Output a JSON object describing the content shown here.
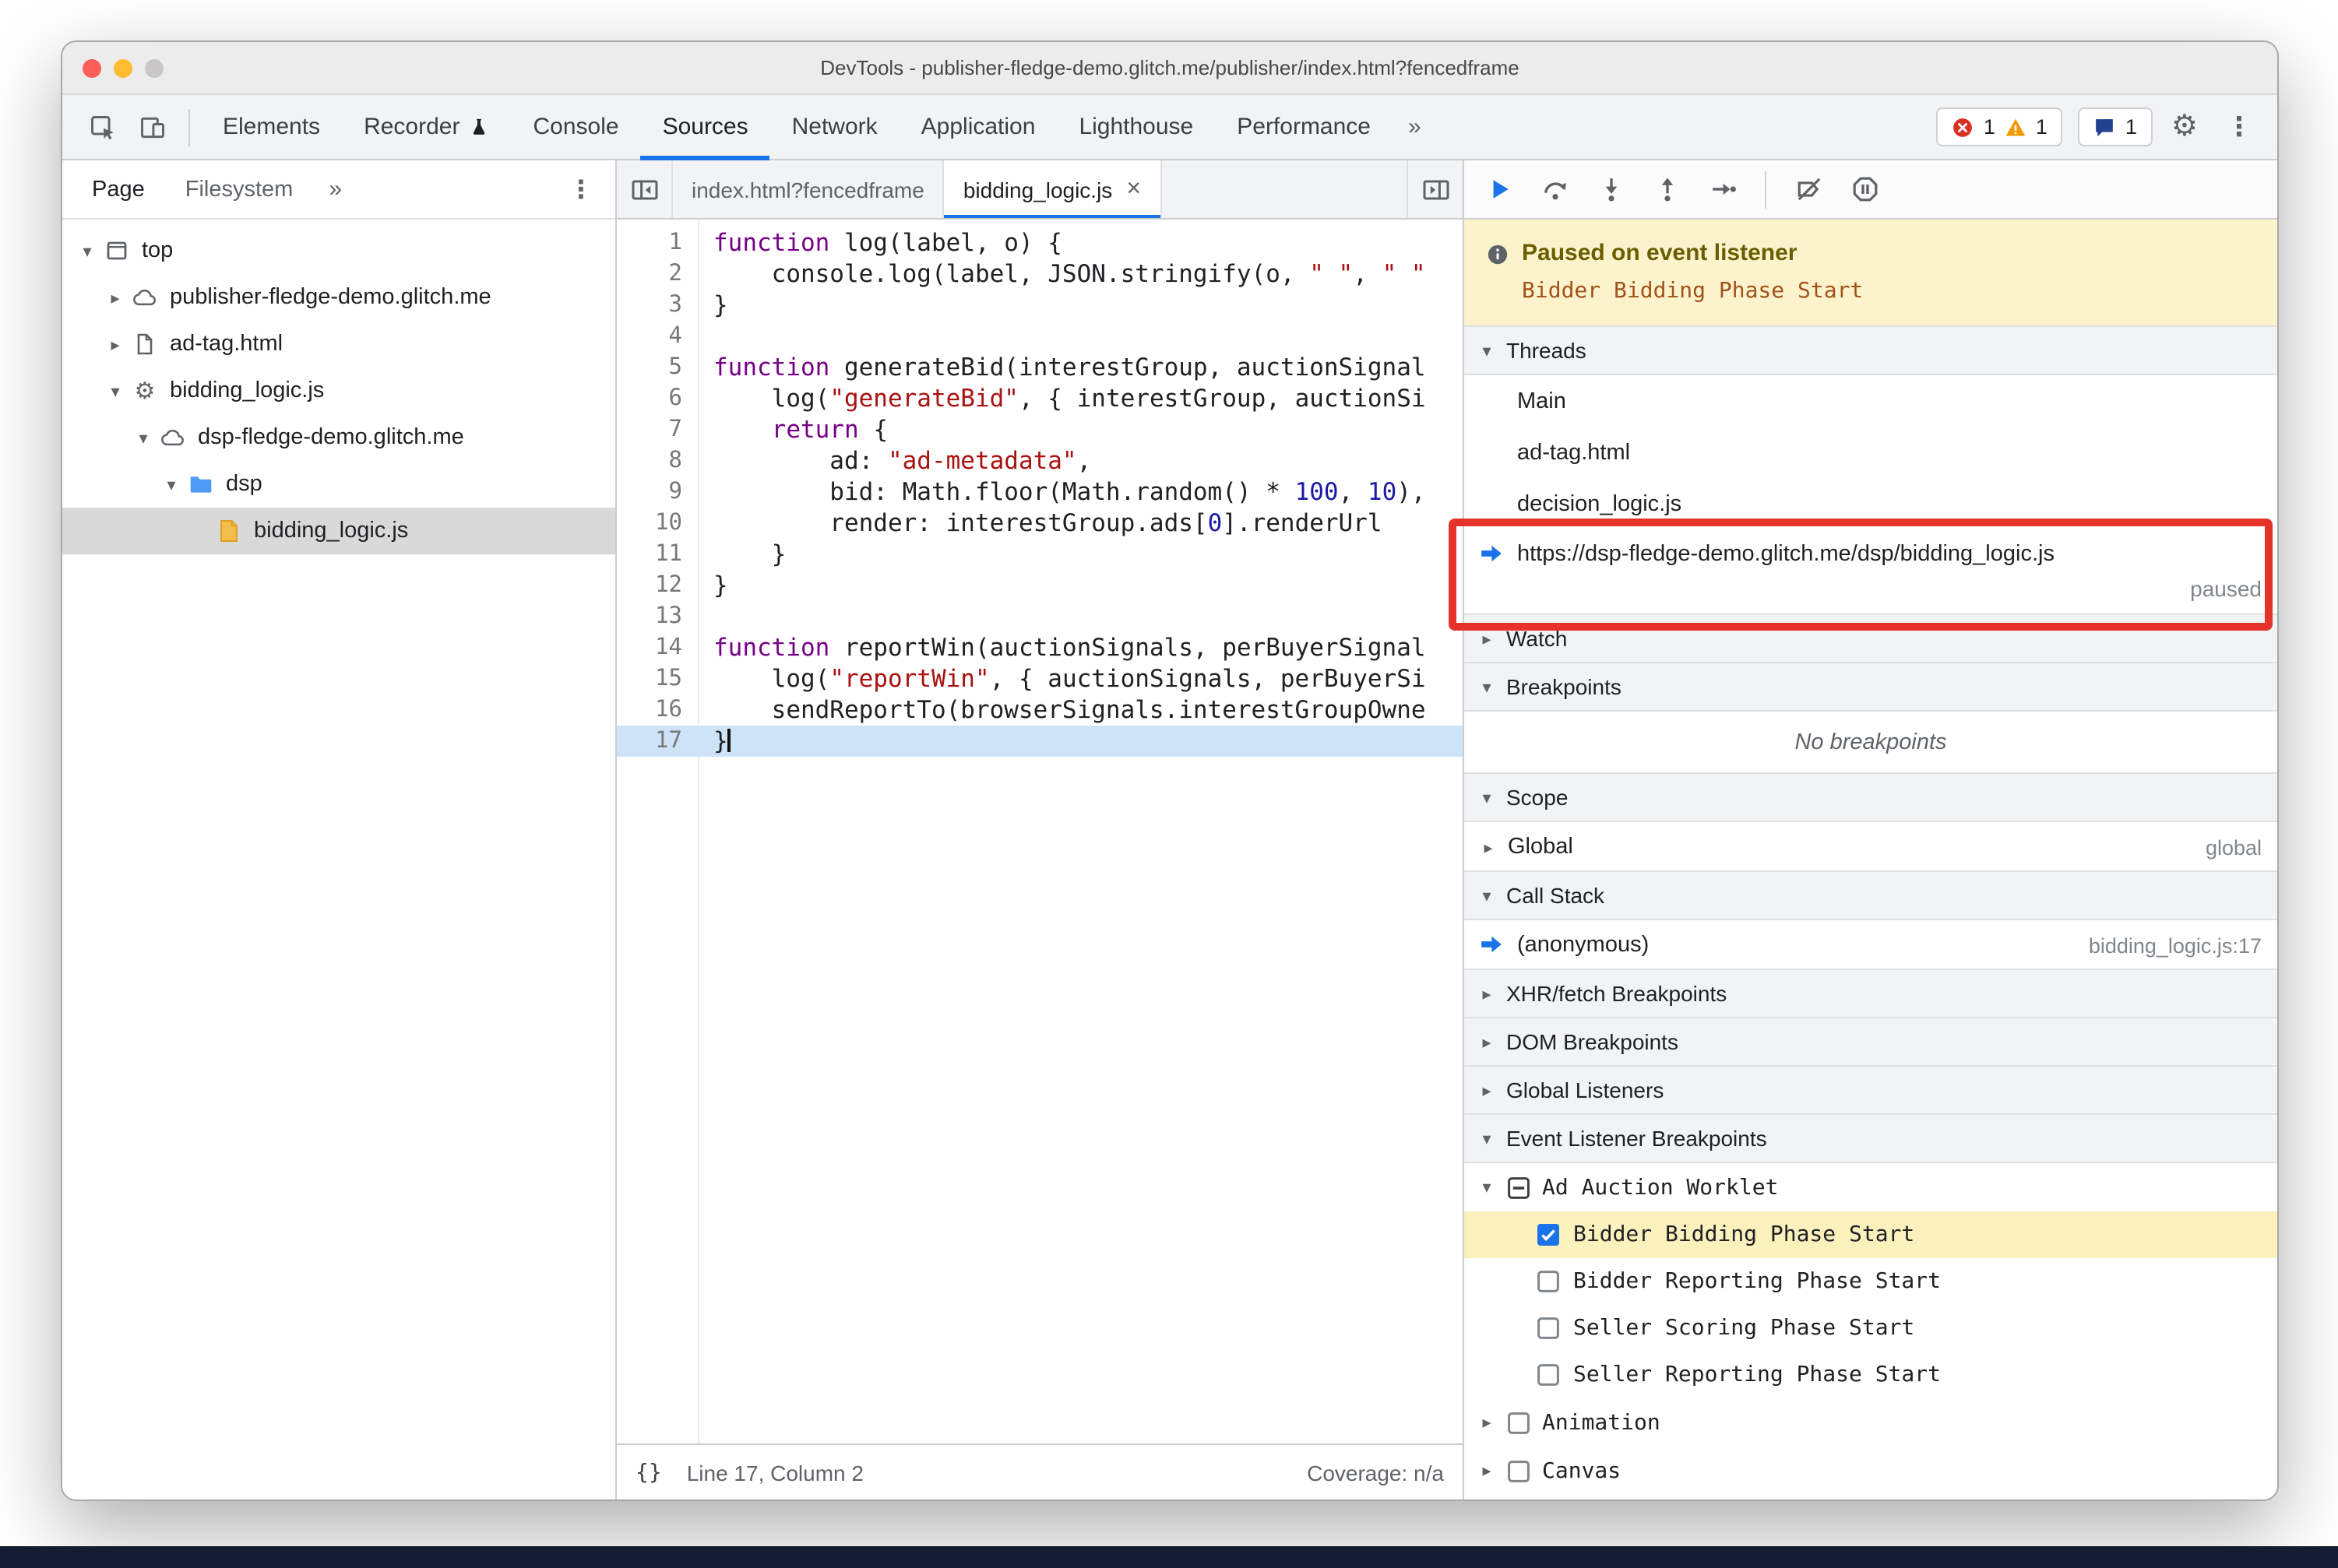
{
  "icons": {
    "triangle_down": "▾",
    "triangle_right": "▸",
    "section_down": "▼",
    "section_right": "▶",
    "chevrons": "»",
    "kebab": "⋮",
    "gear_glyph": "⚙",
    "pretty_print": "{}"
  },
  "colors": {
    "accent_blue": "#1a73e8",
    "annotation_red": "#e5332c",
    "exec_line_highlight": "#cee3f8",
    "breakpoint_highlight": "#fbf1bd",
    "paused_banner_bg": "#fcf3cd"
  },
  "window": {
    "title": "DevTools - publisher-fledge-demo.glitch.me/publisher/index.html?fencedframe"
  },
  "toolbar": {
    "tabs": [
      {
        "label": "Elements"
      },
      {
        "label": "Recorder",
        "badge": "flask"
      },
      {
        "label": "Console"
      },
      {
        "label": "Sources",
        "active": true
      },
      {
        "label": "Network"
      },
      {
        "label": "Application"
      },
      {
        "label": "Lighthouse"
      },
      {
        "label": "Performance"
      }
    ],
    "more_tabs": "»",
    "error_count": "1",
    "warning_count": "1",
    "issues_count": "1"
  },
  "sidebar": {
    "tabs": [
      {
        "label": "Page",
        "active": true
      },
      {
        "label": "Filesystem"
      }
    ],
    "more_tabs": "»",
    "overflow_menu": "⋮",
    "tree": [
      {
        "label": "top",
        "icon": "frame",
        "depth": 0,
        "arrow": "down"
      },
      {
        "label": "publisher-fledge-demo.glitch.me",
        "icon": "cloud",
        "depth": 1,
        "arrow": "right"
      },
      {
        "label": "ad-tag.html",
        "icon": "doc",
        "depth": 1,
        "arrow": "right"
      },
      {
        "label": "bidding_logic.js",
        "icon": "gear",
        "depth": 1,
        "arrow": "down"
      },
      {
        "label": "dsp-fledge-demo.glitch.me",
        "icon": "cloud",
        "depth": 2,
        "arrow": "down"
      },
      {
        "label": "dsp",
        "icon": "folder",
        "depth": 3,
        "arrow": "down"
      },
      {
        "label": "bidding_logic.js",
        "icon": "jsfile",
        "depth": 4,
        "arrow": null,
        "selected": true
      }
    ]
  },
  "editor": {
    "tabs": [
      {
        "label": "index.html?fencedframe"
      },
      {
        "label": "bidding_logic.js",
        "active": true,
        "close": "×"
      }
    ],
    "lines": [
      {
        "n": 1,
        "t": [
          [
            "kw",
            "function"
          ],
          [
            "pl",
            " log(label, o) {"
          ]
        ]
      },
      {
        "n": 2,
        "t": [
          [
            "pl",
            "    console.log(label, JSON.stringify(o, "
          ],
          [
            "str",
            "\" \""
          ],
          [
            "pl",
            ", "
          ],
          [
            "str",
            "\" \""
          ]
        ]
      },
      {
        "n": 3,
        "t": [
          [
            "pl",
            "}"
          ]
        ]
      },
      {
        "n": 4,
        "t": []
      },
      {
        "n": 5,
        "t": [
          [
            "kw",
            "function"
          ],
          [
            "pl",
            " generateBid(interestGroup, auctionSignal"
          ]
        ]
      },
      {
        "n": 6,
        "t": [
          [
            "pl",
            "    log("
          ],
          [
            "str",
            "\"generateBid\""
          ],
          [
            "pl",
            ", { interestGroup, auctionSi"
          ]
        ]
      },
      {
        "n": 7,
        "t": [
          [
            "pl",
            "    "
          ],
          [
            "kw",
            "return"
          ],
          [
            "pl",
            " {"
          ]
        ]
      },
      {
        "n": 8,
        "t": [
          [
            "pl",
            "        ad: "
          ],
          [
            "str",
            "\"ad-metadata\""
          ],
          [
            "pl",
            ","
          ]
        ]
      },
      {
        "n": 9,
        "t": [
          [
            "pl",
            "        bid: Math.floor(Math.random() * "
          ],
          [
            "num",
            "100"
          ],
          [
            "pl",
            ", "
          ],
          [
            "num",
            "10"
          ],
          [
            "pl",
            "),"
          ]
        ]
      },
      {
        "n": 10,
        "t": [
          [
            "pl",
            "        render: interestGroup.ads["
          ],
          [
            "num",
            "0"
          ],
          [
            "pl",
            "].renderUrl"
          ]
        ]
      },
      {
        "n": 11,
        "t": [
          [
            "pl",
            "    }"
          ]
        ]
      },
      {
        "n": 12,
        "t": [
          [
            "pl",
            "}"
          ]
        ]
      },
      {
        "n": 13,
        "t": []
      },
      {
        "n": 14,
        "t": [
          [
            "kw",
            "function"
          ],
          [
            "pl",
            " reportWin(auctionSignals, perBuyerSignal"
          ]
        ]
      },
      {
        "n": 15,
        "t": [
          [
            "pl",
            "    log("
          ],
          [
            "str",
            "\"reportWin\""
          ],
          [
            "pl",
            ", { auctionSignals, perBuyerSi"
          ]
        ]
      },
      {
        "n": 16,
        "t": [
          [
            "pl",
            "    sendReportTo(browserSignals.interestGroupOwne"
          ]
        ]
      },
      {
        "n": 17,
        "t": [
          [
            "pl",
            "}"
          ]
        ],
        "exec": true
      }
    ],
    "status": {
      "position": "Line 17, Column 2",
      "coverage": "Coverage: n/a"
    }
  },
  "debugger": {
    "toolbar": [
      "resume",
      "step-over",
      "step-into",
      "step-out",
      "step",
      "sep",
      "deactivate-breakpoints",
      "pause-on-exceptions"
    ],
    "banner": {
      "title": "Paused on event listener",
      "detail": "Bidder Bidding Phase Start"
    },
    "threads": {
      "label": "Threads",
      "items": [
        {
          "label": "Main"
        },
        {
          "label": "ad-tag.html"
        },
        {
          "label": "decision_logic.js"
        },
        {
          "label": "https://dsp-fledge-demo.glitch.me/dsp/bidding_logic.js",
          "status": "paused",
          "current": true,
          "annotated": true
        }
      ]
    },
    "watch": {
      "label": "Watch"
    },
    "breakpoints": {
      "label": "Breakpoints",
      "empty": "No breakpoints"
    },
    "scope": {
      "label": "Scope",
      "rows": [
        {
          "label": "Global",
          "right": "global"
        }
      ]
    },
    "call_stack": {
      "label": "Call Stack",
      "rows": [
        {
          "label": "(anonymous)",
          "location": "bidding_logic.js:17",
          "current": true
        }
      ]
    },
    "collapsed_sections": [
      "XHR/fetch Breakpoints",
      "DOM Breakpoints",
      "Global Listeners"
    ],
    "event_listener_breakpoints": {
      "label": "Event Listener Breakpoints",
      "groups": [
        {
          "label": "Ad Auction Worklet",
          "state": "indeterminate",
          "expanded": true,
          "items": [
            {
              "label": "Bidder Bidding Phase Start",
              "checked": true,
              "highlighted": true
            },
            {
              "label": "Bidder Reporting Phase Start",
              "checked": false
            },
            {
              "label": "Seller Scoring Phase Start",
              "checked": false
            },
            {
              "label": "Seller Reporting Phase Start",
              "checked": false
            }
          ]
        },
        {
          "label": "Animation",
          "state": "unchecked",
          "expanded": false,
          "items": []
        },
        {
          "label": "Canvas",
          "state": "unchecked",
          "expanded": false,
          "items": []
        }
      ]
    }
  }
}
